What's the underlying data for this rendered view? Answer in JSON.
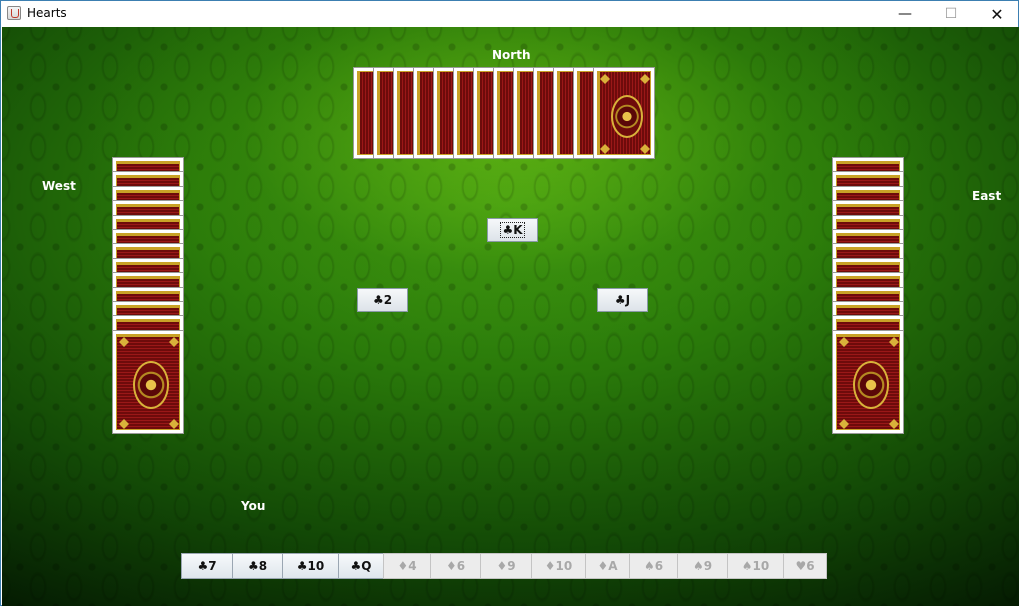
{
  "window": {
    "title": "Hearts",
    "minimize": "—",
    "maximize": "☐",
    "close": "✕"
  },
  "players": {
    "north": "North",
    "west": "West",
    "east": "East",
    "south": "You"
  },
  "opponent_card_counts": {
    "north": 13,
    "west": 13,
    "east": 13
  },
  "trick": {
    "north": "♣K",
    "west": "♣2",
    "east": "♣J"
  },
  "hand": [
    {
      "label": "♣7",
      "enabled": true
    },
    {
      "label": "♣8",
      "enabled": true
    },
    {
      "label": "♣10",
      "enabled": true
    },
    {
      "label": "♣Q",
      "enabled": true
    },
    {
      "label": "♦4",
      "enabled": false
    },
    {
      "label": "♦6",
      "enabled": false
    },
    {
      "label": "♦9",
      "enabled": false
    },
    {
      "label": "♦10",
      "enabled": false
    },
    {
      "label": "♦A",
      "enabled": false
    },
    {
      "label": "♠6",
      "enabled": false
    },
    {
      "label": "♠9",
      "enabled": false
    },
    {
      "label": "♠10",
      "enabled": false
    },
    {
      "label": "♥6",
      "enabled": false
    }
  ],
  "colors": {
    "felt": "#2a7a0a",
    "card_back": "#8e1414",
    "card_trim": "#c9a227"
  }
}
